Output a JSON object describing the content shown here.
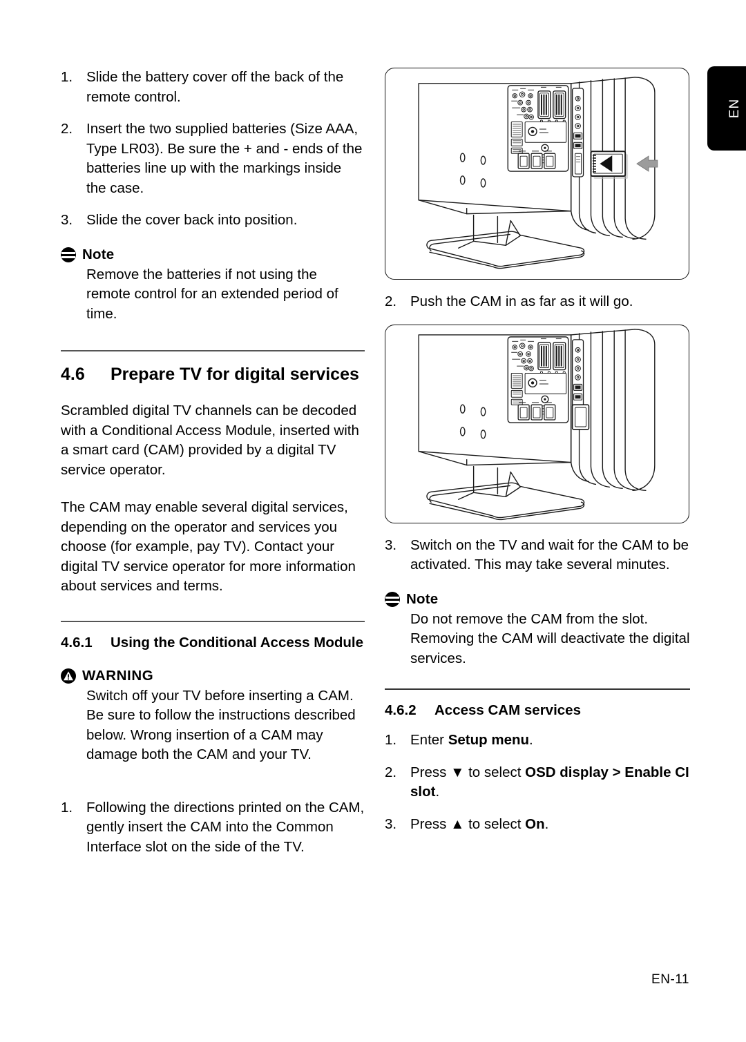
{
  "page": {
    "language_tab": "EN",
    "footer": "EN-11"
  },
  "left_column": {
    "battery_steps": [
      {
        "num": "1.",
        "text": "Slide the battery cover off the back of the remote control."
      },
      {
        "num": "2.",
        "text": "Insert the two supplied batteries (Size AAA, Type LR03). Be sure the + and - ends of the batteries line up with the markings inside the case."
      },
      {
        "num": "3.",
        "text": "Slide the cover back into position."
      }
    ],
    "note": {
      "icon": "note-icon",
      "label": "Note",
      "text": "Remove the batteries if not using the remote control for an extended period of time."
    },
    "section_46": {
      "number": "4.6",
      "title": "Prepare TV for digital services",
      "paragraphs": [
        "Scrambled digital TV channels can be decoded with a Conditional Access Module, inserted with a smart card (CAM) provided by a digital TV service operator.",
        "The CAM may enable several digital services, depending on the operator and services you choose (for example, pay TV). Contact your digital TV service operator for more information about services and terms."
      ]
    },
    "section_461": {
      "number": "4.6.1",
      "title": "Using the Conditional Access Module",
      "warning": {
        "icon": "warning-icon",
        "label": "WARNING",
        "text": "Switch off your TV before inserting a CAM. Be sure to follow the instructions described below. Wrong insertion of a CAM may damage both the CAM and your TV."
      },
      "steps": [
        {
          "num": "1.",
          "text": "Following the directions printed on the CAM, gently insert the CAM into the Common Interface slot on the side of the TV."
        }
      ]
    }
  },
  "right_column": {
    "figure_1": {
      "name": "tv-rear-panel-cam-insert-illustration",
      "caption_marks": [
        "0",
        "0",
        "0",
        "0"
      ]
    },
    "step_2": {
      "num": "2.",
      "text": "Push the CAM in as far as it will go."
    },
    "figure_2": {
      "name": "tv-rear-panel-cam-inserted-illustration",
      "caption_marks": [
        "0",
        "0",
        "0",
        "0"
      ]
    },
    "step_3": {
      "num": "3.",
      "text": "Switch on the TV and wait for the CAM to be activated. This may take several minutes."
    },
    "note": {
      "icon": "note-icon",
      "label": "Note",
      "text": "Do not remove the CAM from the slot. Removing the CAM will deactivate the digital services."
    },
    "section_462": {
      "number": "4.6.2",
      "title": "Access CAM services",
      "steps": [
        {
          "num": "1.",
          "parts": [
            {
              "text": "Enter ",
              "bold": false
            },
            {
              "text": "Setup menu",
              "bold": true
            },
            {
              "text": ".",
              "bold": false
            }
          ]
        },
        {
          "num": "2.",
          "parts": [
            {
              "text": "Press ",
              "bold": false
            },
            {
              "text": "▼",
              "bold": false
            },
            {
              "text": " to select ",
              "bold": false
            },
            {
              "text": "OSD display",
              "bold": true
            },
            {
              "text": " > ",
              "bold": true
            },
            {
              "text": "Enable CI slot",
              "bold": true
            },
            {
              "text": ".",
              "bold": false
            }
          ]
        },
        {
          "num": "3.",
          "parts": [
            {
              "text": "Press ",
              "bold": false
            },
            {
              "text": "▲",
              "bold": false
            },
            {
              "text": " to select ",
              "bold": false
            },
            {
              "text": "On",
              "bold": true
            },
            {
              "text": ".",
              "bold": false
            }
          ]
        }
      ]
    }
  },
  "colors": {
    "rule": "#555555",
    "tab_background": "#000000",
    "tab_text": "#ffffff",
    "line_art": "#1a1a1a",
    "arrow_fill": "#999999"
  }
}
